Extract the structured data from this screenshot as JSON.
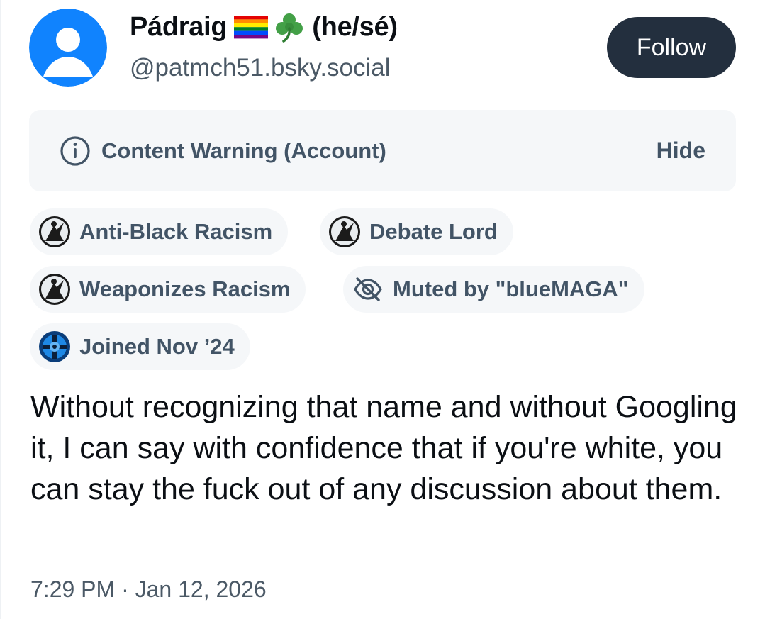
{
  "author": {
    "display_name": "Pádraig",
    "flag_icon": "rainbow-flag-icon",
    "shamrock_icon": "shamrock-icon",
    "pronouns": "(he/sé)",
    "handle": "@patmch51.bsky.social",
    "avatar_icon": "default-avatar-icon",
    "avatar_color": "#1083fe"
  },
  "follow_button": {
    "label": "Follow",
    "color": "#232f3e"
  },
  "content_warning": {
    "icon": "info-circle-icon",
    "label": "Content Warning (Account)",
    "action_label": "Hide"
  },
  "labels": [
    {
      "icon": "labeler-avatar-icon",
      "text": "Anti-Black Racism"
    },
    {
      "icon": "labeler-avatar-icon",
      "text": "Debate Lord"
    },
    {
      "icon": "labeler-avatar-icon",
      "text": "Weaponizes Racism"
    },
    {
      "icon": "eye-slash-icon",
      "text": "Muted by \"blueMAGA\""
    },
    {
      "icon": "labeler-avatar-icon",
      "text": "Joined Nov ’24"
    }
  ],
  "post": {
    "text": "Without recognizing that name and without Googling it, I can say with confidence that if you're white, you can stay the fuck out of any discussion about them.",
    "timestamp": "7:29 PM · Jan 12, 2026"
  },
  "colors": {
    "chip_background": "#f5f7f9",
    "muted_text": "#425466",
    "handle_text": "#4b5966"
  }
}
